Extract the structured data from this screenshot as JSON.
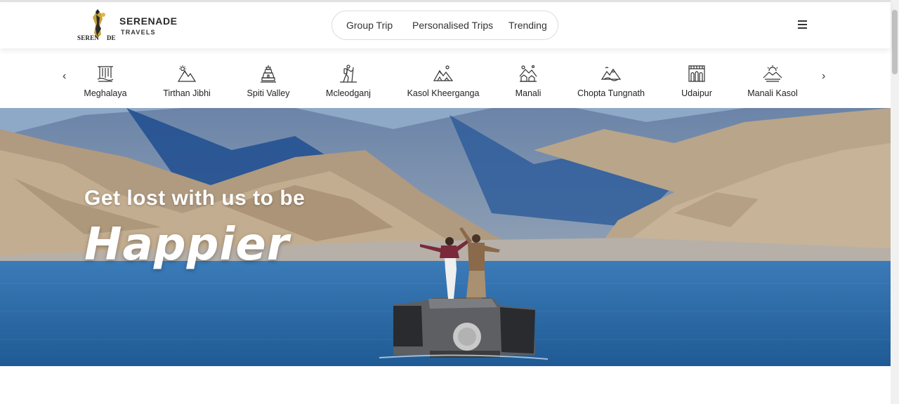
{
  "brand": {
    "name": "SERENADE",
    "sub": "TRAVELS",
    "mark_left": "SEREN",
    "mark_right": "DE"
  },
  "nav": {
    "links": [
      "Group Trip",
      "Personalised Trips",
      "Trending"
    ]
  },
  "menu": {
    "icon": "hamburger-menu-icon"
  },
  "destinations": {
    "prev_icon": "‹",
    "next_icon": "›",
    "items": [
      {
        "label": "Meghalaya",
        "icon": "waterfall-icon"
      },
      {
        "label": "Tirthan Jibhi",
        "icon": "mountain-sun-icon"
      },
      {
        "label": "Spiti Valley",
        "icon": "monastery-icon"
      },
      {
        "label": "Mcleodganj",
        "icon": "hiker-icon"
      },
      {
        "label": "Kasol Kheerganga",
        "icon": "mountain-camp-icon"
      },
      {
        "label": "Manali",
        "icon": "hill-village-icon"
      },
      {
        "label": "Chopta Tungnath",
        "icon": "peaks-icon"
      },
      {
        "label": "Udaipur",
        "icon": "palace-icon"
      },
      {
        "label": "Manali Kasol",
        "icon": "sunrise-mountains-icon"
      }
    ]
  },
  "hero": {
    "subtitle": "Get lost with us to be",
    "title": "Happier"
  },
  "colors": {
    "sky": "#8ea9c8",
    "lake": "#2d6aa8",
    "mountain": "#b8a58c",
    "text_on_hero": "#ffffff"
  }
}
